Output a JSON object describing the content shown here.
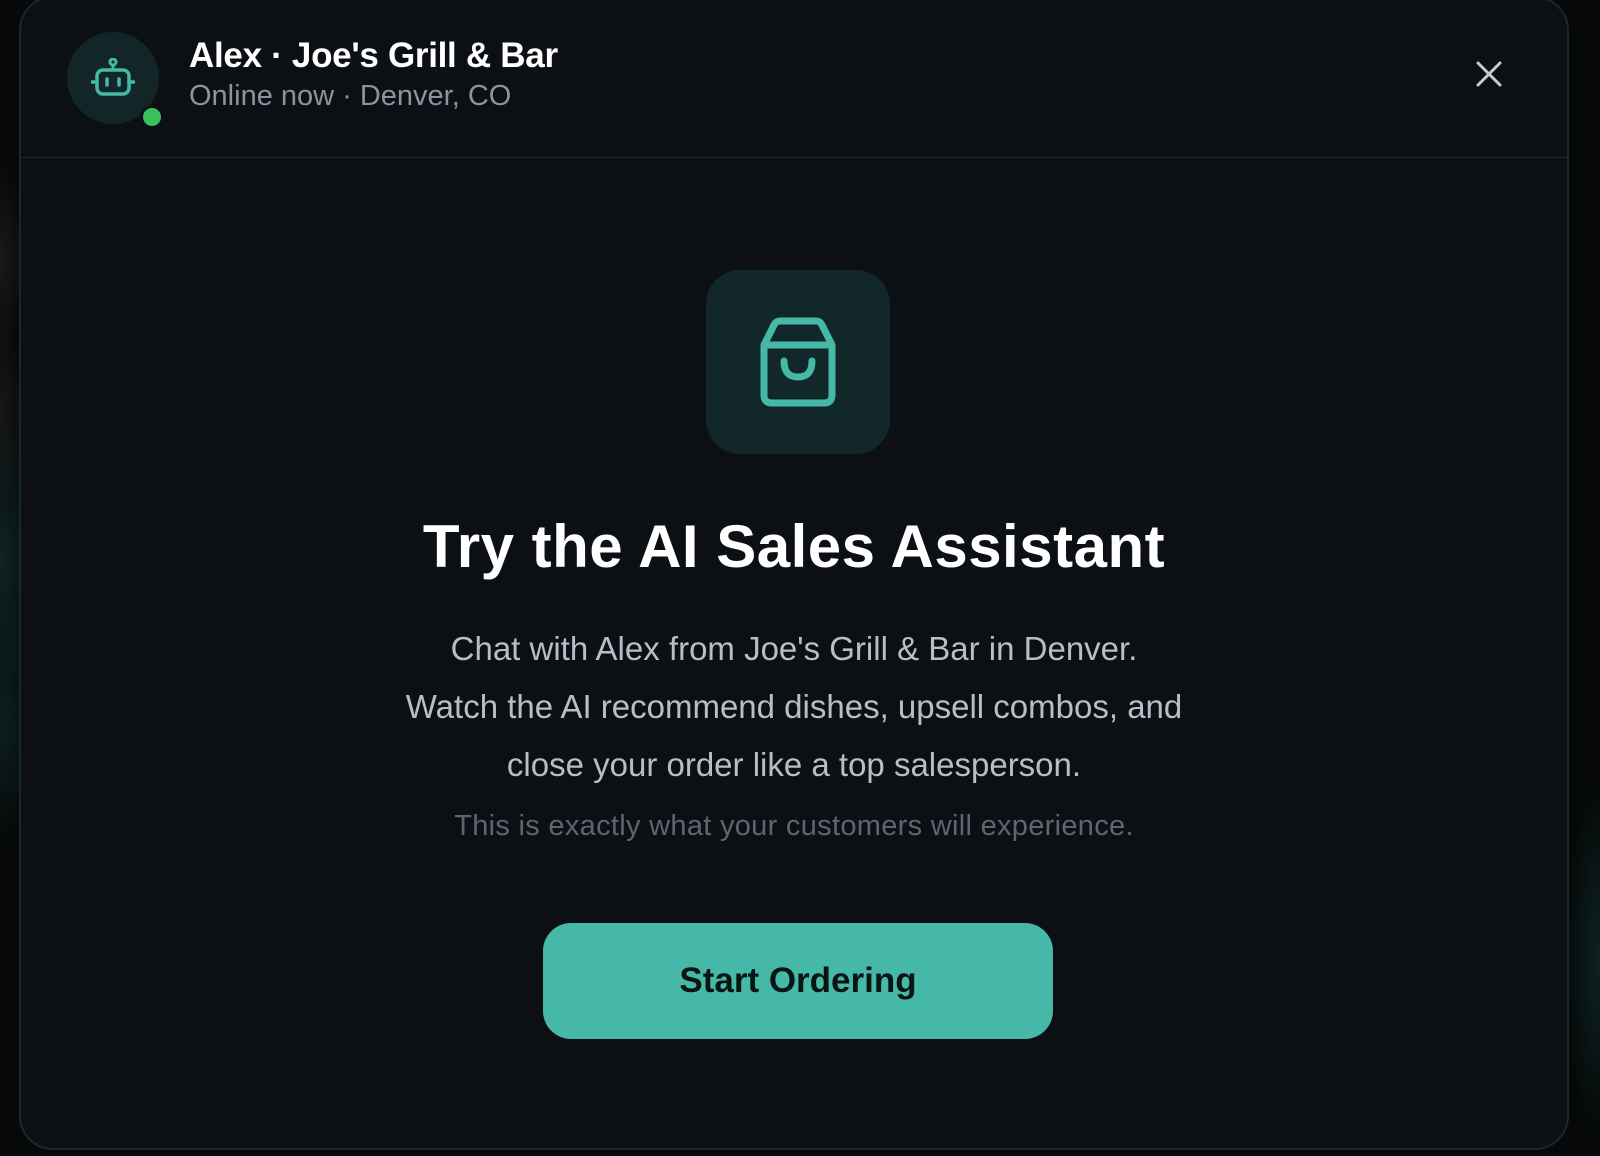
{
  "header": {
    "agent_name": "Alex · Joe's Grill & Bar",
    "status": "Online now · Denver, CO",
    "avatar_icon": "robot-icon",
    "close_icon": "close-icon"
  },
  "hero": {
    "icon": "shopping-bag-icon",
    "title": "Try the AI Sales Assistant",
    "description_lines": [
      "Chat with Alex from Joe's Grill & Bar in Denver.",
      "Watch the AI recommend dishes, upsell combos, and",
      "close your order like a top salesperson."
    ],
    "note": "This is exactly what your customers will experience."
  },
  "cta": {
    "label": "Start Ordering"
  },
  "colors": {
    "accent": "#45b8a8",
    "online": "#3ac05a",
    "background": "#0c1015"
  }
}
